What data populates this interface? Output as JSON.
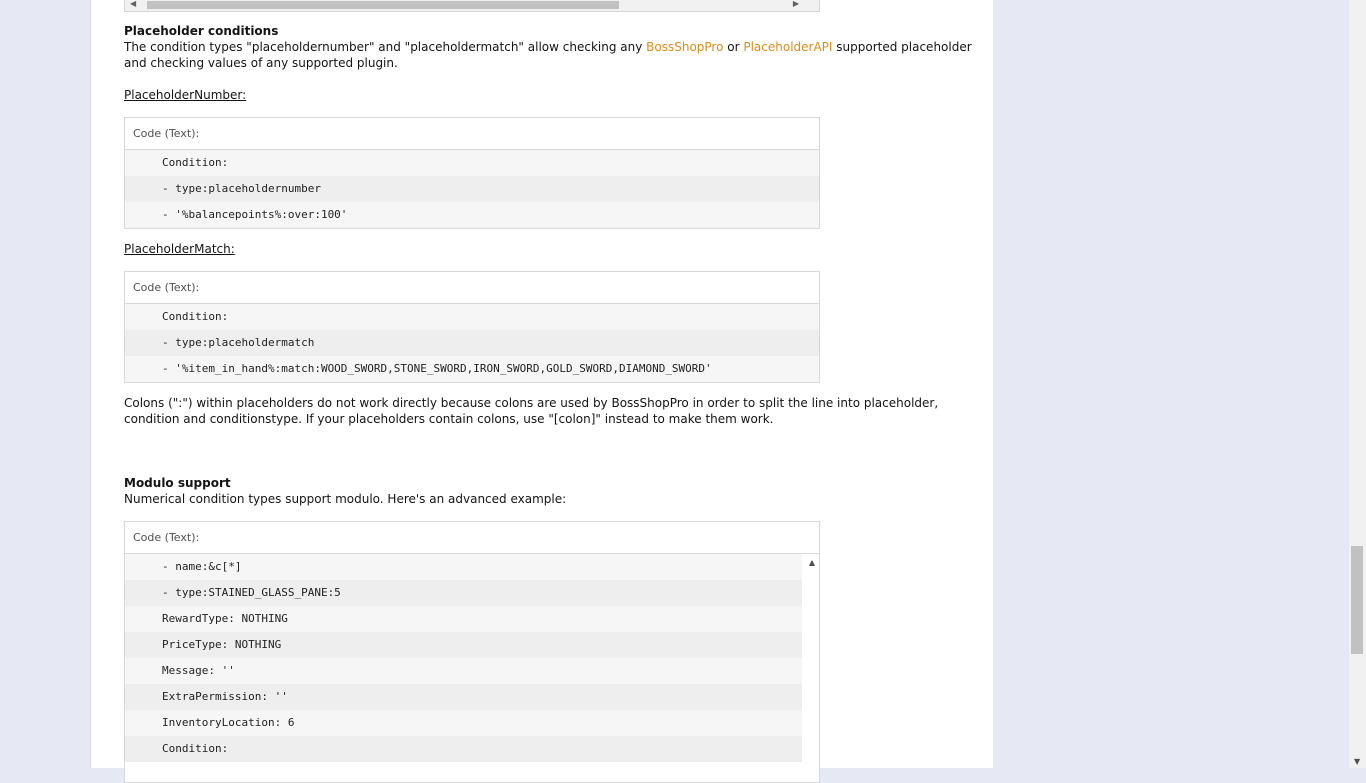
{
  "placeholder_section": {
    "title": "Placeholder conditions",
    "intro_part1": "The condition types \"placeholdernumber\" and \"placeholdermatch\" allow checking any ",
    "link1": "BossShopPro",
    "intro_part2": " or ",
    "link2": "PlaceholderAPI",
    "intro_part3": " supported placeholder",
    "intro_line2": "and checking values of any supported plugin.",
    "number_label": "PlaceholderNumber:",
    "match_label": "PlaceholderMatch:",
    "note_line1": "Colons (\":\") within placeholders do not work directly because colons are used by BossShopPro in order to split the line into placeholder,",
    "note_line2": "condition and conditionstype. If your placeholders contain colons, use \"[colon]\" instead to make them work."
  },
  "code_number": {
    "header": "Code (Text):",
    "lines": [
      "Condition:",
      "- type:placeholdernumber",
      "- '%balancepoints%:over:100'"
    ]
  },
  "code_match": {
    "header": "Code (Text):",
    "lines": [
      "Condition:",
      "- type:placeholdermatch",
      "- '%item_in_hand%:match:WOOD_SWORD,STONE_SWORD,IRON_SWORD,GOLD_SWORD,DIAMOND_SWORD'"
    ]
  },
  "modulo_section": {
    "title": "Modulo support",
    "intro": "Numerical condition types support modulo. Here's an advanced example:"
  },
  "code_modulo": {
    "header": "Code (Text):",
    "lines": [
      "- name:&c[*]",
      "- type:STAINED_GLASS_PANE:5",
      "RewardType: NOTHING",
      "PriceType: NOTHING",
      "Message: ''",
      "ExtraPermission: ''",
      "InventoryLocation: 6",
      "Condition:"
    ]
  },
  "icons": {
    "scroll_left": "triangle-left-icon",
    "scroll_right": "triangle-right-icon",
    "scroll_up": "triangle-up-icon",
    "scroll_down": "triangle-down-icon"
  },
  "colors": {
    "link": "#d88e1b",
    "background": "#e6e8f4"
  }
}
